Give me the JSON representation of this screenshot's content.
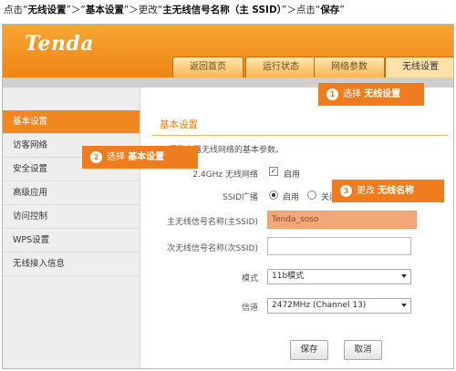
{
  "instruction": {
    "p1": "点击“",
    "b1": "无线设置",
    "p2": "”＞“",
    "b2": "基本设置",
    "p3": "”＞更改“",
    "b3": "主无线信号名称（主 SSID）",
    "p4": "”＞点击“",
    "b4": "保存",
    "p5": "”"
  },
  "header": {
    "logo": "Tenda",
    "tabs": [
      "返回首页",
      "运行状态",
      "网络参数",
      "无线设置"
    ],
    "active_tab": "无线设置"
  },
  "sidebar": {
    "items": [
      "基本设置",
      "访客网络",
      "安全设置",
      "高级应用",
      "访问控制",
      "WPS设置",
      "无线接入信息"
    ],
    "active": "基本设置"
  },
  "main": {
    "section_title": "基本设置",
    "description": "置路由器无线网络的基本参数。",
    "band_label": "2.4GHz 无线网络",
    "band_checkbox": "启用",
    "ssid_broadcast_label": "SSID广播",
    "ssid_broadcast_on": "启用",
    "ssid_broadcast_off": "关闭",
    "primary_ssid_label": "主无线信号名称(主SSID)",
    "primary_ssid_value": "Tenda_soso",
    "secondary_ssid_label": "次无线信号名称(次SSID)",
    "secondary_ssid_value": "",
    "mode_label": "模式",
    "mode_value": "11b模式",
    "channel_label": "信道",
    "channel_value": "2472MHz (Channel 13)",
    "save_label": "保存",
    "cancel_label": "取消"
  },
  "callouts": [
    {
      "num": "1",
      "text": "选择",
      "bold": "无线设置"
    },
    {
      "num": "2",
      "text": "选择",
      "bold": "基本设置"
    },
    {
      "num": "3",
      "text": "更改",
      "bold": "无线名称"
    }
  ],
  "colors": {
    "brand_orange": "#f1871f",
    "callout_orange": "#ef7d1f",
    "highlight_input": "#f3a87a"
  }
}
